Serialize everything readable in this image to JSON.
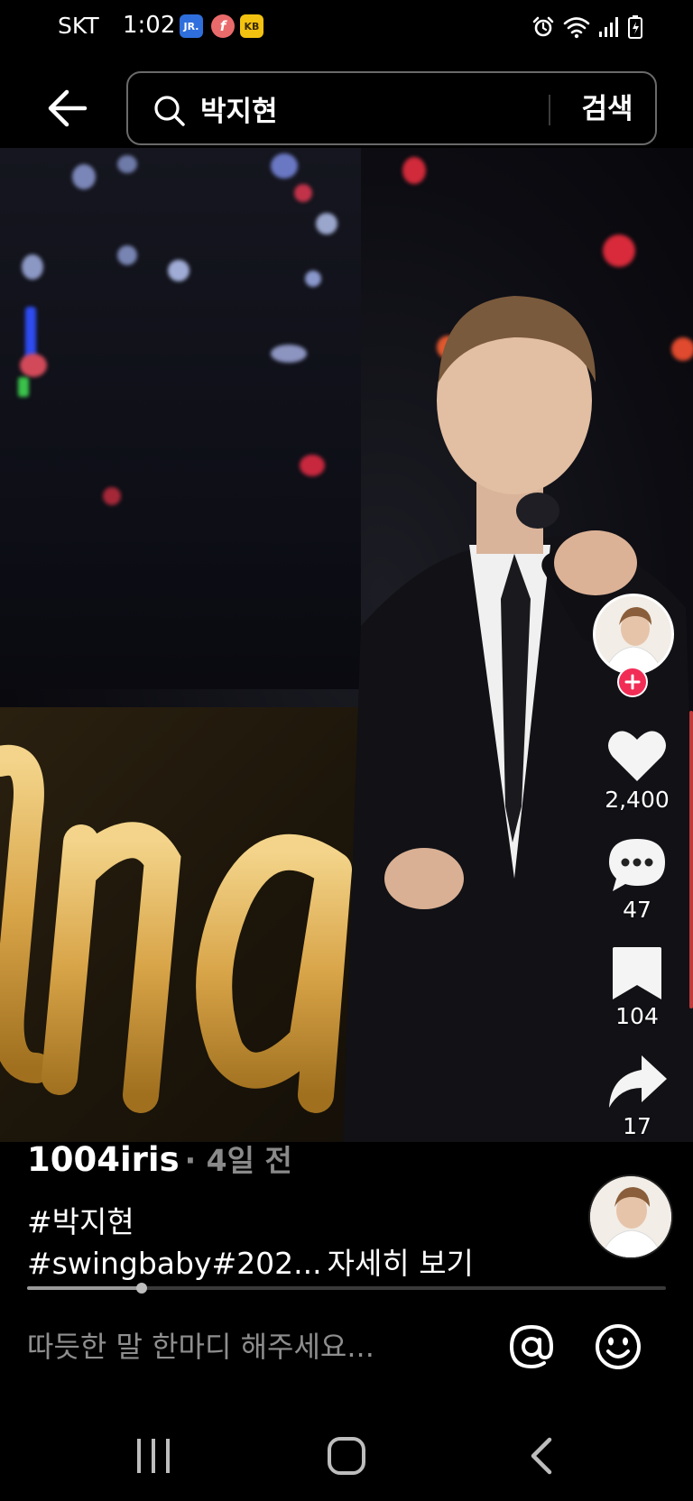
{
  "status_bar": {
    "carrier": "SKT",
    "time": "1:02",
    "app_icons": [
      "jr-app-icon",
      "f-app-icon",
      "kb-app-icon"
    ],
    "app_icon_labels": [
      "JR.",
      "f",
      "KB"
    ]
  },
  "search": {
    "query": "박지현",
    "button_label": "검색"
  },
  "post": {
    "author": "1004iris",
    "time_label": "· 4일 전",
    "hashtag_line1": "#박지현",
    "hashtag_line2": "#swingbaby#202...",
    "see_more": "자세히 보기",
    "progress_fraction": 0.18
  },
  "actions": {
    "likes": "2,400",
    "comments": "47",
    "bookmarks": "104",
    "shares": "17"
  },
  "comment": {
    "placeholder": "따듯한 말 한마디 해주세요..."
  },
  "colors": {
    "background": "#000000",
    "follow_accent": "#f12d56",
    "secondary_text": "#8a8a8a"
  }
}
